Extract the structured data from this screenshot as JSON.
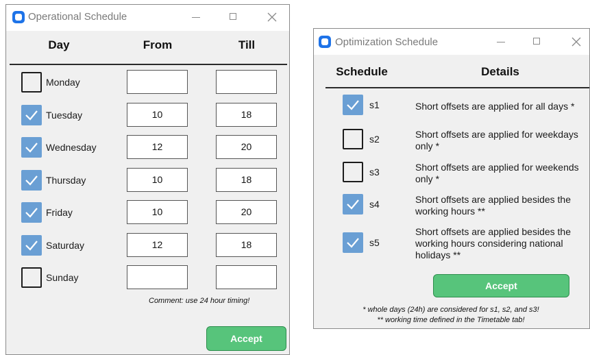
{
  "operational": {
    "title": "Operational Schedule",
    "headers": {
      "day": "Day",
      "from": "From",
      "till": "Till"
    },
    "rows": [
      {
        "day": "Monday",
        "checked": false,
        "from": "",
        "till": ""
      },
      {
        "day": "Tuesday",
        "checked": true,
        "from": "10",
        "till": "18"
      },
      {
        "day": "Wednesday",
        "checked": true,
        "from": "12",
        "till": "20"
      },
      {
        "day": "Thursday",
        "checked": true,
        "from": "10",
        "till": "18"
      },
      {
        "day": "Friday",
        "checked": true,
        "from": "10",
        "till": "20"
      },
      {
        "day": "Saturday",
        "checked": true,
        "from": "12",
        "till": "18"
      },
      {
        "day": "Sunday",
        "checked": false,
        "from": "",
        "till": ""
      }
    ],
    "comment": "Comment: use 24 hour timing!",
    "accept_label": "Accept"
  },
  "optimization": {
    "title": "Optimization Schedule",
    "headers": {
      "schedule": "Schedule",
      "details": "Details"
    },
    "rows": [
      {
        "id": "s1",
        "checked": true,
        "details": "Short offsets are applied for all days  *"
      },
      {
        "id": "s2",
        "checked": false,
        "details": "Short offsets are applied for weekdays only  *"
      },
      {
        "id": "s3",
        "checked": false,
        "details": "Short offsets are applied for weekends only  *"
      },
      {
        "id": "s4",
        "checked": true,
        "details": "Short offsets are applied besides the working hours  **"
      },
      {
        "id": "s5",
        "checked": true,
        "details": "Short offsets are applied besides the working hours considering national holidays  **"
      }
    ],
    "accept_label": "Accept",
    "notes": [
      "* whole days (24h) are considered for s1, s2, and s3!",
      "** working time defined in the Timetable tab!"
    ]
  },
  "colors": {
    "checkbox_checked": "#6a9fd4",
    "accept_button": "#57c47b",
    "app_icon": "#1e73e8"
  }
}
